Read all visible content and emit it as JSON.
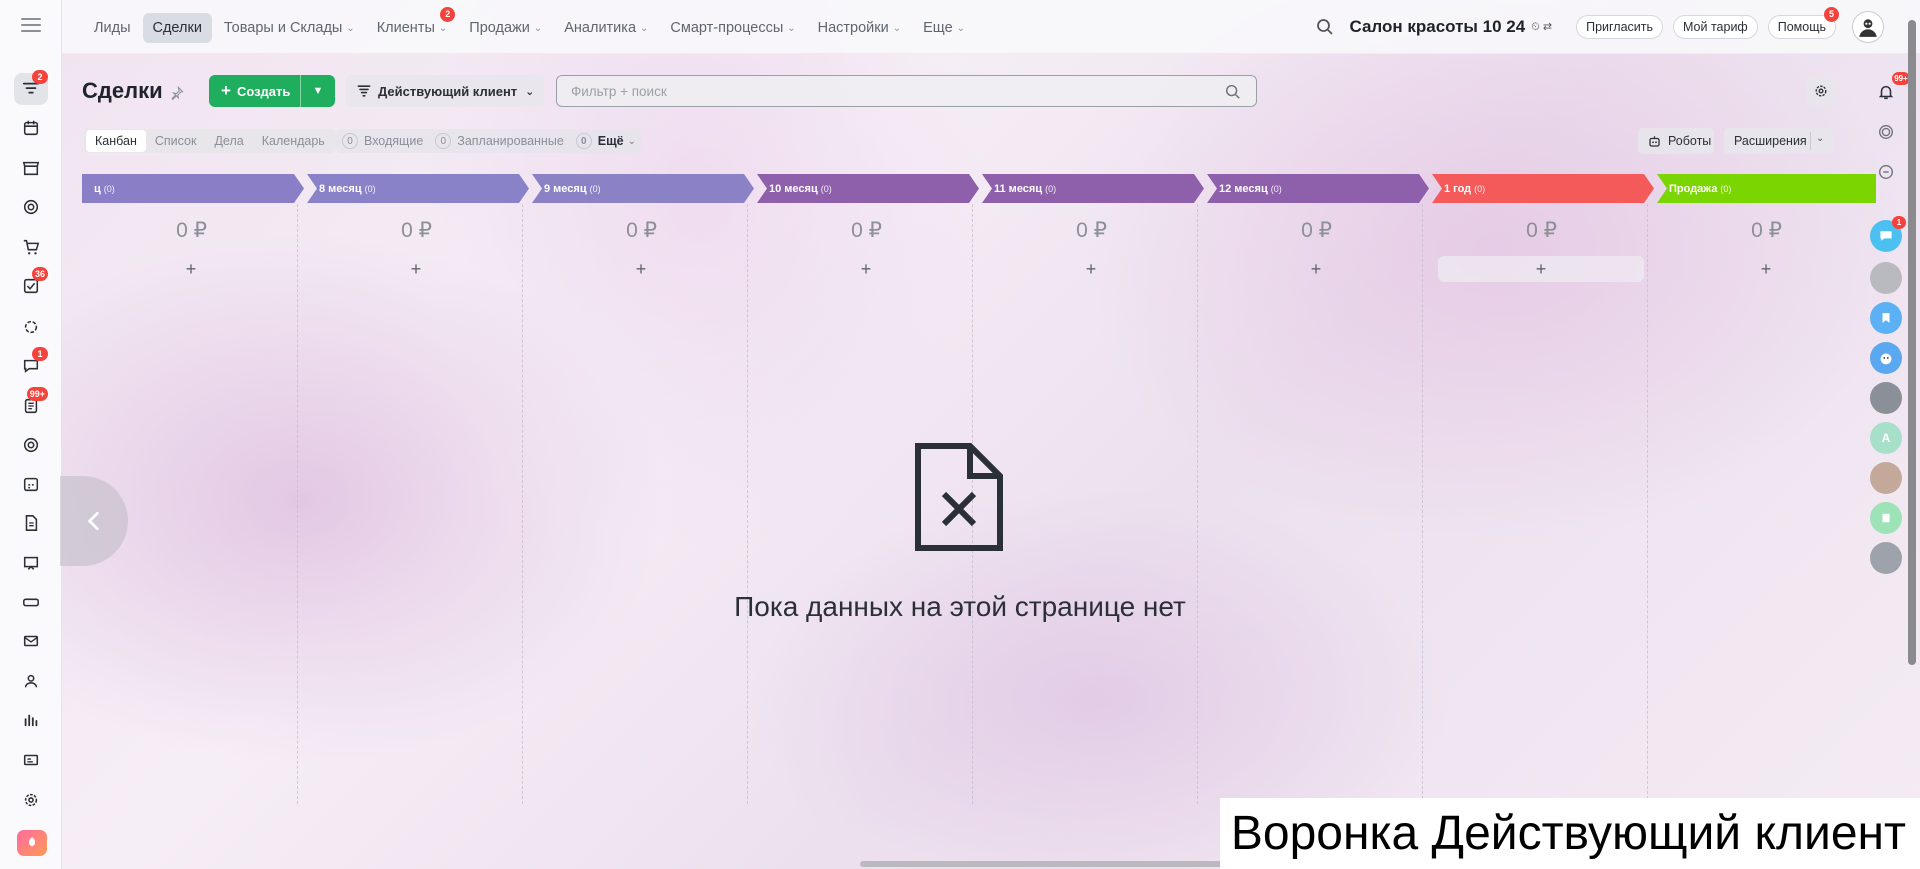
{
  "nav": {
    "items": [
      {
        "label": "Лиды",
        "active": false,
        "dropdown": false,
        "badge": ""
      },
      {
        "label": "Сделки",
        "active": true,
        "dropdown": false,
        "badge": ""
      },
      {
        "label": "Товары и Склады",
        "active": false,
        "dropdown": true,
        "badge": ""
      },
      {
        "label": "Клиенты",
        "active": false,
        "dropdown": true,
        "badge": "2"
      },
      {
        "label": "Продажи",
        "active": false,
        "dropdown": true,
        "badge": ""
      },
      {
        "label": "Аналитика",
        "active": false,
        "dropdown": true,
        "badge": ""
      },
      {
        "label": "Смарт-процессы",
        "active": false,
        "dropdown": true,
        "badge": ""
      },
      {
        "label": "Настройки",
        "active": false,
        "dropdown": true,
        "badge": ""
      },
      {
        "label": "Еще",
        "active": false,
        "dropdown": true,
        "badge": ""
      }
    ]
  },
  "header": {
    "company": "Салон красоты 10 24",
    "invite_label": "Пригласить",
    "tariff_label": "Мой тариф",
    "help_label": "Помощь",
    "help_badge": "5"
  },
  "sidebar": {
    "badges": {
      "funnel": "2",
      "tasks": "36",
      "chat": "1",
      "feed": "99+"
    }
  },
  "page": {
    "title": "Сделки",
    "create_label": "Создать",
    "funnel_label": "Действующий клиент",
    "search_placeholder": "Фильтр + поиск",
    "notifications_badge": "99+"
  },
  "views": {
    "tabs": [
      "Канбан",
      "Список",
      "Дела",
      "Календарь"
    ],
    "active": "Канбан",
    "counters": [
      {
        "num": "0",
        "label": "Входящие"
      },
      {
        "num": "0",
        "label": "Запланированные"
      },
      {
        "num": "0",
        "label": "Ещё"
      }
    ],
    "robots_label": "Роботы",
    "extensions_label": "Расширения"
  },
  "kanban": {
    "stages": [
      {
        "name": "ц",
        "count": "(0)",
        "sum": "0 ₽",
        "color": "#8a7ec6"
      },
      {
        "name": "8 месяц",
        "count": "(0)",
        "sum": "0 ₽",
        "color": "#8a82c8"
      },
      {
        "name": "9 месяц",
        "count": "(0)",
        "sum": "0 ₽",
        "color": "#8a82c4"
      },
      {
        "name": "10 месяц",
        "count": "(0)",
        "sum": "0 ₽",
        "color": "#8e5fab"
      },
      {
        "name": "11 месяц",
        "count": "(0)",
        "sum": "0 ₽",
        "color": "#8e5fab"
      },
      {
        "name": "12 месяц",
        "count": "(0)",
        "sum": "0 ₽",
        "color": "#8e5fab"
      },
      {
        "name": "1 год",
        "count": "(0)",
        "sum": "0 ₽",
        "color": "#f45a5a"
      },
      {
        "name": "Продажа",
        "count": "(0)",
        "sum": "0 ₽",
        "color": "#7bd500"
      }
    ],
    "add_label": "+"
  },
  "empty": {
    "text": "Пока данных на этой странице нет"
  },
  "caption": {
    "text": "Воронка Действующий клиент"
  },
  "right_panel": {
    "chat_badge": "1",
    "avatar_letter": "A"
  },
  "colors": {
    "accent": "#1fad5e",
    "badge": "#f4433c"
  }
}
